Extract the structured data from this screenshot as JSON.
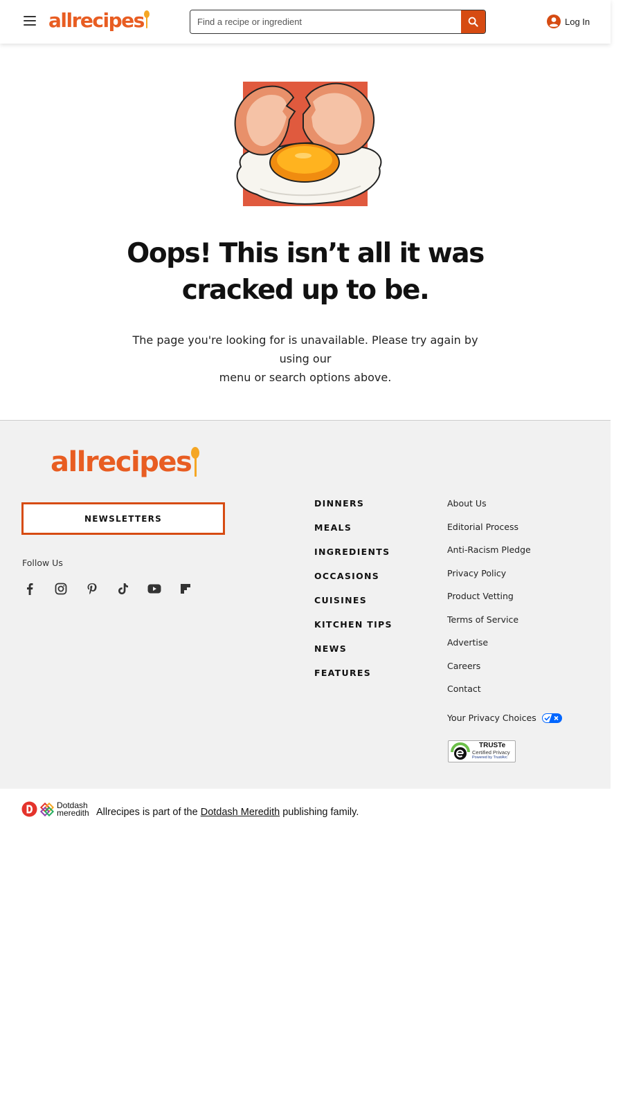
{
  "header": {
    "logo_text": "allrecipes",
    "search_placeholder": "Find a recipe or ingredient",
    "login_label": "Log In"
  },
  "main": {
    "headline_line1": "Oops! This isn’t all it was",
    "headline_line2": "cracked up to be.",
    "message_line1": "The page you're looking for is unavailable. Please try again by using our",
    "message_line2": "menu or search options above."
  },
  "footer": {
    "logo_text": "allrecipes",
    "newsletter_label": "NEWSLETTERS",
    "follow_label": "Follow Us",
    "social_icons": [
      "facebook-icon",
      "instagram-icon",
      "pinterest-icon",
      "tiktok-icon",
      "youtube-icon",
      "flipboard-icon"
    ],
    "categories": [
      "DINNERS",
      "MEALS",
      "INGREDIENTS",
      "OCCASIONS",
      "CUISINES",
      "KITCHEN TIPS",
      "NEWS",
      "FEATURES"
    ],
    "links": [
      "About Us",
      "Editorial Process",
      "Anti-Racism Pledge",
      "Privacy Policy",
      "Product Vetting",
      "Terms of Service",
      "Advertise",
      "Careers",
      "Contact"
    ],
    "privacy_choices": "Your Privacy Choices",
    "truste": {
      "title": "TRUSTe",
      "line1": "Certified Privacy",
      "line2": "Powered by TrustArc"
    }
  },
  "bottom": {
    "dm_line1": "Dotdash",
    "dm_line2": "meredith",
    "text_before": "Allrecipes is part of the ",
    "link_text": "Dotdash Meredith",
    "text_after": " publishing family."
  },
  "colors": {
    "brand_orange": "#e85d22",
    "accent_red": "#d64b12",
    "spoon_yellow": "#f5a623",
    "footer_bg": "#f1f1f1"
  }
}
